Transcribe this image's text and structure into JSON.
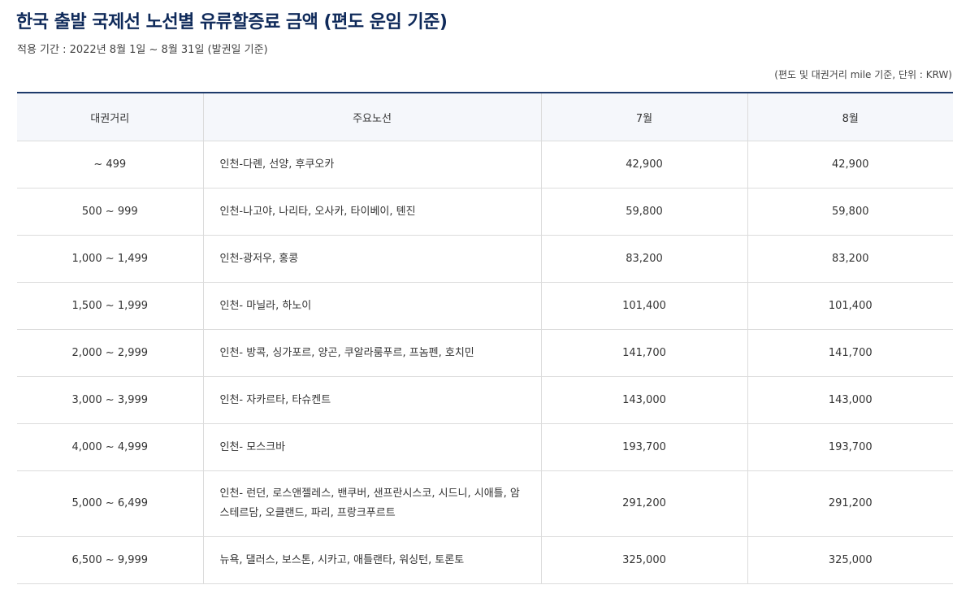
{
  "title": "한국 출발 국제선 노선별 유류할증료 금액 (편도 운임 기준)",
  "period": "적용 기간 : 2022년 8월 1일 ~ 8월 31일 (발권일 기준)",
  "unit_note": "(편도 및 대권거리 mile 기준, 단위 : KRW)",
  "table": {
    "headers": [
      "대권거리",
      "주요노선",
      "7월",
      "8월"
    ],
    "rows": [
      {
        "distance": "~ 499",
        "routes": "인천-다롄, 선양, 후쿠오카",
        "jul": "42,900",
        "aug": "42,900"
      },
      {
        "distance": "500 ~ 999",
        "routes": "인천-나고야, 나리타, 오사카, 타이베이, 톈진",
        "jul": "59,800",
        "aug": "59,800"
      },
      {
        "distance": "1,000 ~ 1,499",
        "routes": "인천-광저우, 홍콩",
        "jul": "83,200",
        "aug": "83,200"
      },
      {
        "distance": "1,500 ~ 1,999",
        "routes": "인천- 마닐라, 하노이",
        "jul": "101,400",
        "aug": "101,400"
      },
      {
        "distance": "2,000 ~ 2,999",
        "routes": "인천- 방콕, 싱가포르, 양곤, 쿠알라룸푸르, 프놈펜, 호치민",
        "jul": "141,700",
        "aug": "141,700"
      },
      {
        "distance": "3,000 ~ 3,999",
        "routes": "인천- 자카르타, 타슈켄트",
        "jul": "143,000",
        "aug": "143,000"
      },
      {
        "distance": "4,000 ~ 4,999",
        "routes": "인천- 모스크바",
        "jul": "193,700",
        "aug": "193,700"
      },
      {
        "distance": "5,000 ~ 6,499",
        "routes": "인천- 런던, 로스앤젤레스, 밴쿠버, 샌프란시스코, 시드니, 시애틀, 암스테르담, 오클랜드, 파리, 프랑크푸르트",
        "jul": "291,200",
        "aug": "291,200"
      },
      {
        "distance": "6,500 ~ 9,999",
        "routes": "뉴욕, 댈러스, 보스톤, 시카고, 애틀랜타, 워싱턴, 토론토",
        "jul": "325,000",
        "aug": "325,000"
      }
    ]
  }
}
